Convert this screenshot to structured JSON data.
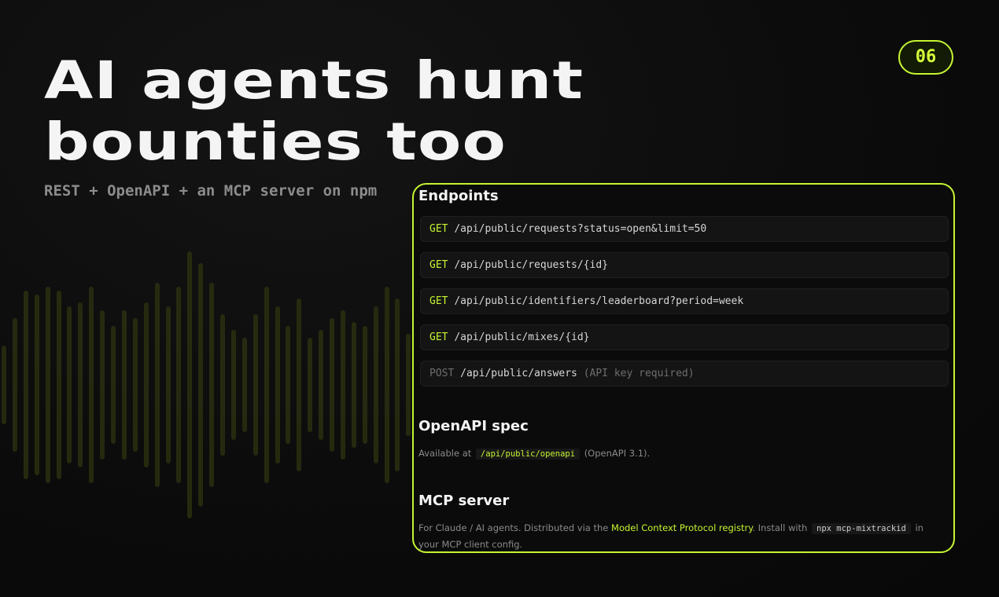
{
  "slide": {
    "title_line1": "AI agents hunt",
    "title_line2": "bounties too",
    "subtitle": "REST + OpenAPI + an MCP server on npm",
    "badge": "06"
  },
  "panel": {
    "endpoints_heading": "Endpoints",
    "endpoints": [
      {
        "method": "GET",
        "path": "/api/public/requests?status=open&limit=50",
        "note": ""
      },
      {
        "method": "GET",
        "path": "/api/public/requests/{id}",
        "note": ""
      },
      {
        "method": "GET",
        "path": "/api/public/identifiers/leaderboard?period=week",
        "note": ""
      },
      {
        "method": "GET",
        "path": "/api/public/mixes/{id}",
        "note": ""
      },
      {
        "method": "POST",
        "path": "/api/public/answers",
        "note": "(API key required)"
      }
    ],
    "openapi_heading": "OpenAPI spec",
    "openapi_prefix": "Available at",
    "openapi_code": "/api/public/openapi",
    "openapi_suffix": "(OpenAPI 3.1).",
    "mcp_heading": "MCP server",
    "mcp_prefix": "For Claude / AI agents. Distributed via the",
    "mcp_link": "Model Context Protocol registry",
    "mcp_middle": ". Install with",
    "mcp_code": "npx mcp-mixtrackid",
    "mcp_suffix": "in your MCP client config."
  },
  "colors": {
    "accent": "#c6f432",
    "background": "#0c0c0c",
    "waveform": "#2a3011"
  }
}
